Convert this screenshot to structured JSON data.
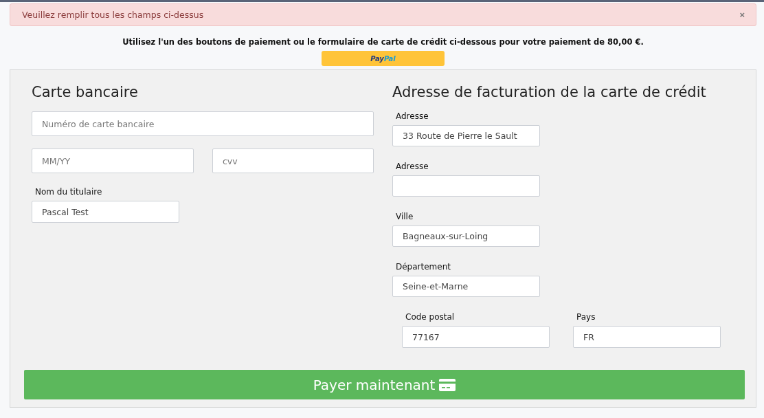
{
  "alert": {
    "message": "Veuillez remplir tous les champs ci-dessus",
    "close": "×"
  },
  "intro": "Utilisez l'un des boutons de paiement ou le formulaire de carte de crédit ci-dessous pour votre paiement de 80,00 €.",
  "paypal_button": {
    "label_parts": [
      "Pay",
      "Pal"
    ]
  },
  "card": {
    "title": "Carte bancaire",
    "number": {
      "placeholder": "Numéro de carte bancaire"
    },
    "expiry": {
      "placeholder": "MM/YY"
    },
    "cvv": {
      "placeholder": "cvv"
    },
    "holder": {
      "label": "Nom du titulaire",
      "value": "Pascal Test"
    }
  },
  "billing": {
    "title": "Adresse de facturation de la carte de crédit",
    "fields": [
      {
        "label": "Adresse",
        "value": "33 Route de Pierre le Sault"
      },
      {
        "label": "Adresse"
      },
      {
        "label": "Ville",
        "value": "Bagneaux-sur-Loing"
      },
      {
        "label": "Département",
        "value": "Seine-et-Marne"
      }
    ],
    "pair": [
      {
        "label": "Code postal",
        "value": "77167"
      },
      {
        "label": "Pays",
        "value": "FR"
      }
    ]
  },
  "pay_button": {
    "label": "Payer maintenant"
  }
}
